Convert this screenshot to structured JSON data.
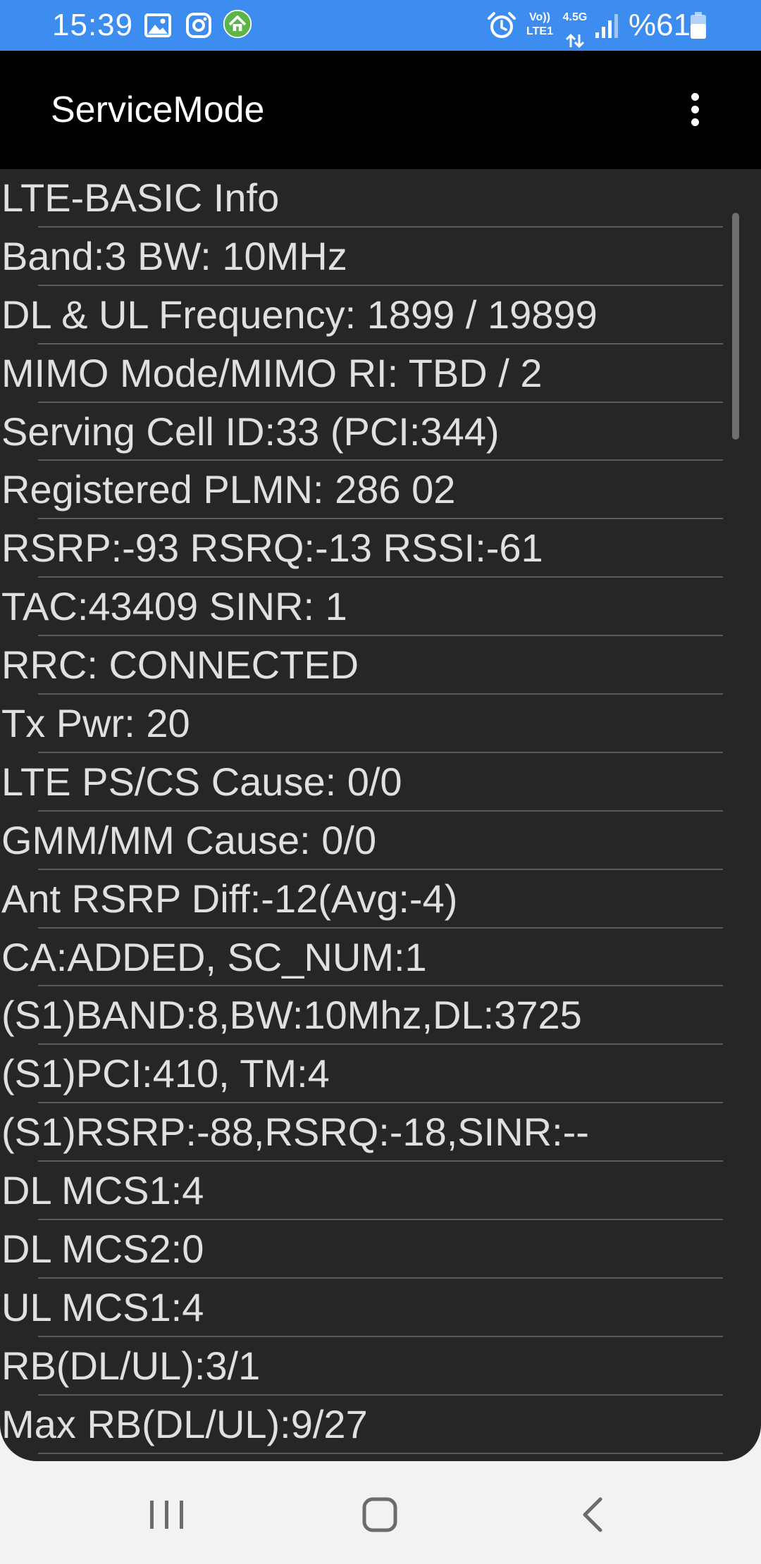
{
  "status_bar": {
    "time": "15:39",
    "net_volte": "Vo))",
    "net_lte": "LTE1",
    "net_gen": "4.5G",
    "battery_percent": "%61",
    "background_color": "#3d8cf0",
    "icons": [
      "gallery-icon",
      "instagram-icon",
      "home-app-icon",
      "alarm-icon",
      "data-arrows-icon",
      "signal-icon",
      "battery-icon"
    ]
  },
  "app_bar": {
    "title": "ServiceMode",
    "menu_icon": "more-vert-icon"
  },
  "info_lines": [
    "LTE-BASIC Info",
    "Band:3 BW: 10MHz",
    "DL & UL Frequency: 1899 / 19899",
    "MIMO Mode/MIMO RI: TBD / 2",
    "Serving Cell ID:33 (PCI:344)",
    "Registered PLMN: 286 02",
    "RSRP:-93 RSRQ:-13 RSSI:-61",
    "TAC:43409 SINR: 1",
    "RRC: CONNECTED",
    "Tx Pwr: 20",
    "LTE PS/CS Cause: 0/0",
    "GMM/MM Cause: 0/0",
    "Ant RSRP Diff:-12(Avg:-4)",
    "CA:ADDED, SC_NUM:1",
    "(S1)BAND:8,BW:10Mhz,DL:3725",
    "(S1)PCI:410, TM:4",
    "(S1)RSRP:-88,RSRQ:-18,SINR:--",
    "DL MCS1:4",
    "DL MCS2:0",
    "UL MCS1:4",
    "RB(DL/UL):3/1",
    "Max RB(DL/UL):9/27"
  ],
  "nav_bar": {
    "buttons": [
      "recents-icon",
      "home-icon",
      "back-icon"
    ]
  }
}
